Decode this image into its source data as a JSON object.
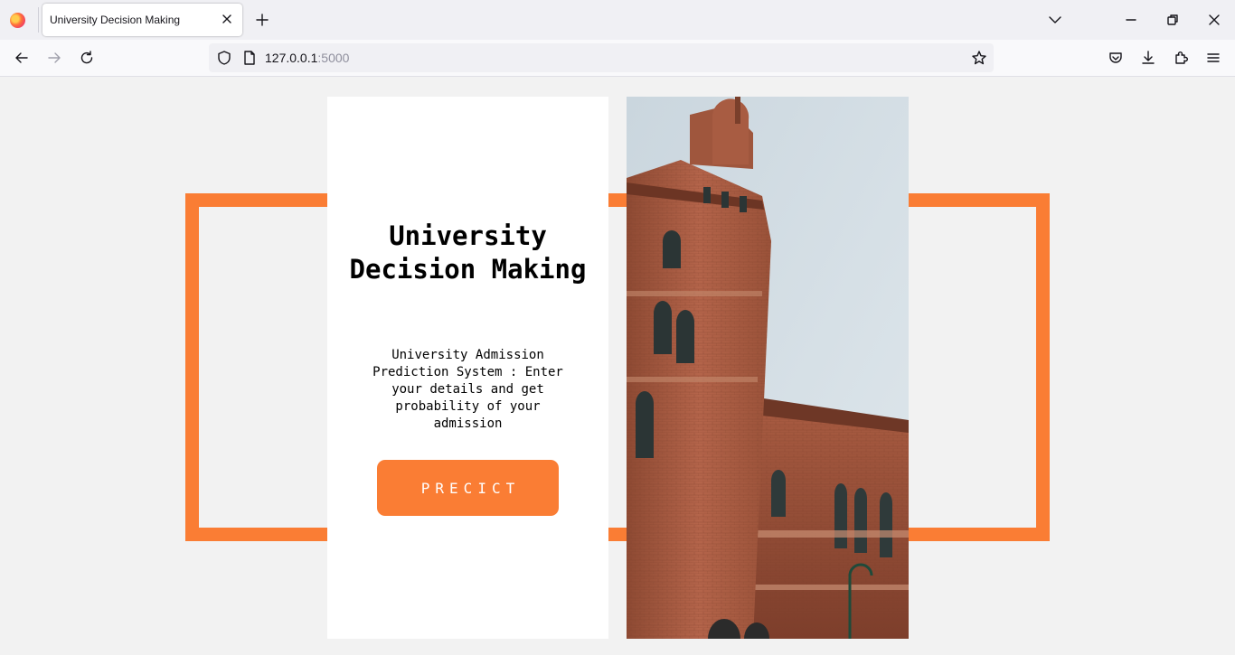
{
  "browser": {
    "tab_title": "University Decision Making",
    "url_host": "127.0.0.1",
    "url_port": ":5000"
  },
  "page": {
    "title": "University Decision Making",
    "description": "University Admission Prediction System : Enter your details and get probability of your admission",
    "predict_label": "PRECICT"
  },
  "colors": {
    "accent": "#fa7d34",
    "card": "#ffffff",
    "background": "#f2f2f2"
  },
  "icons": [
    "firefox-logo-icon",
    "close-icon",
    "plus-icon",
    "chevron-down-icon",
    "minimize-icon",
    "restore-icon",
    "back-arrow-icon",
    "forward-arrow-icon",
    "reload-icon",
    "shield-icon",
    "page-icon",
    "star-icon",
    "pocket-icon",
    "download-icon",
    "extensions-icon",
    "menu-icon"
  ]
}
